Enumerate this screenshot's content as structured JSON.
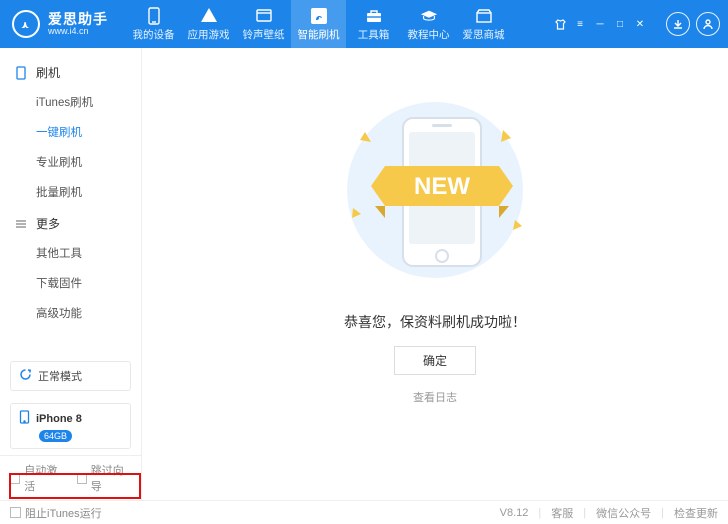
{
  "brand": {
    "name": "爱思助手",
    "url": "www.i4.cn"
  },
  "nav": {
    "items": [
      {
        "label": "我的设备"
      },
      {
        "label": "应用游戏"
      },
      {
        "label": "铃声壁纸"
      },
      {
        "label": "智能刷机"
      },
      {
        "label": "工具箱"
      },
      {
        "label": "教程中心"
      },
      {
        "label": "爱思商城"
      }
    ],
    "active_index": 3
  },
  "sidebar": {
    "sections": [
      {
        "title": "刷机",
        "items": [
          "iTunes刷机",
          "一键刷机",
          "专业刷机",
          "批量刷机"
        ],
        "active_index": 1
      },
      {
        "title": "更多",
        "items": [
          "其他工具",
          "下载固件",
          "高级功能"
        ],
        "active_index": -1
      }
    ],
    "mode_label": "正常模式",
    "device": {
      "name": "iPhone 8",
      "storage": "64GB"
    },
    "bottom_checks": [
      "自动激活",
      "跳过向导"
    ]
  },
  "main": {
    "banner_text": "NEW",
    "success_text": "恭喜您，保资料刷机成功啦！",
    "ok_label": "确定",
    "log_label": "查看日志"
  },
  "footer": {
    "stop_itunes_label": "阻止iTunes运行",
    "version": "V8.12",
    "links": [
      "客服",
      "微信公众号",
      "检查更新"
    ]
  },
  "colors": {
    "primary": "#1d85ea",
    "accent_yellow": "#f7c94a"
  }
}
